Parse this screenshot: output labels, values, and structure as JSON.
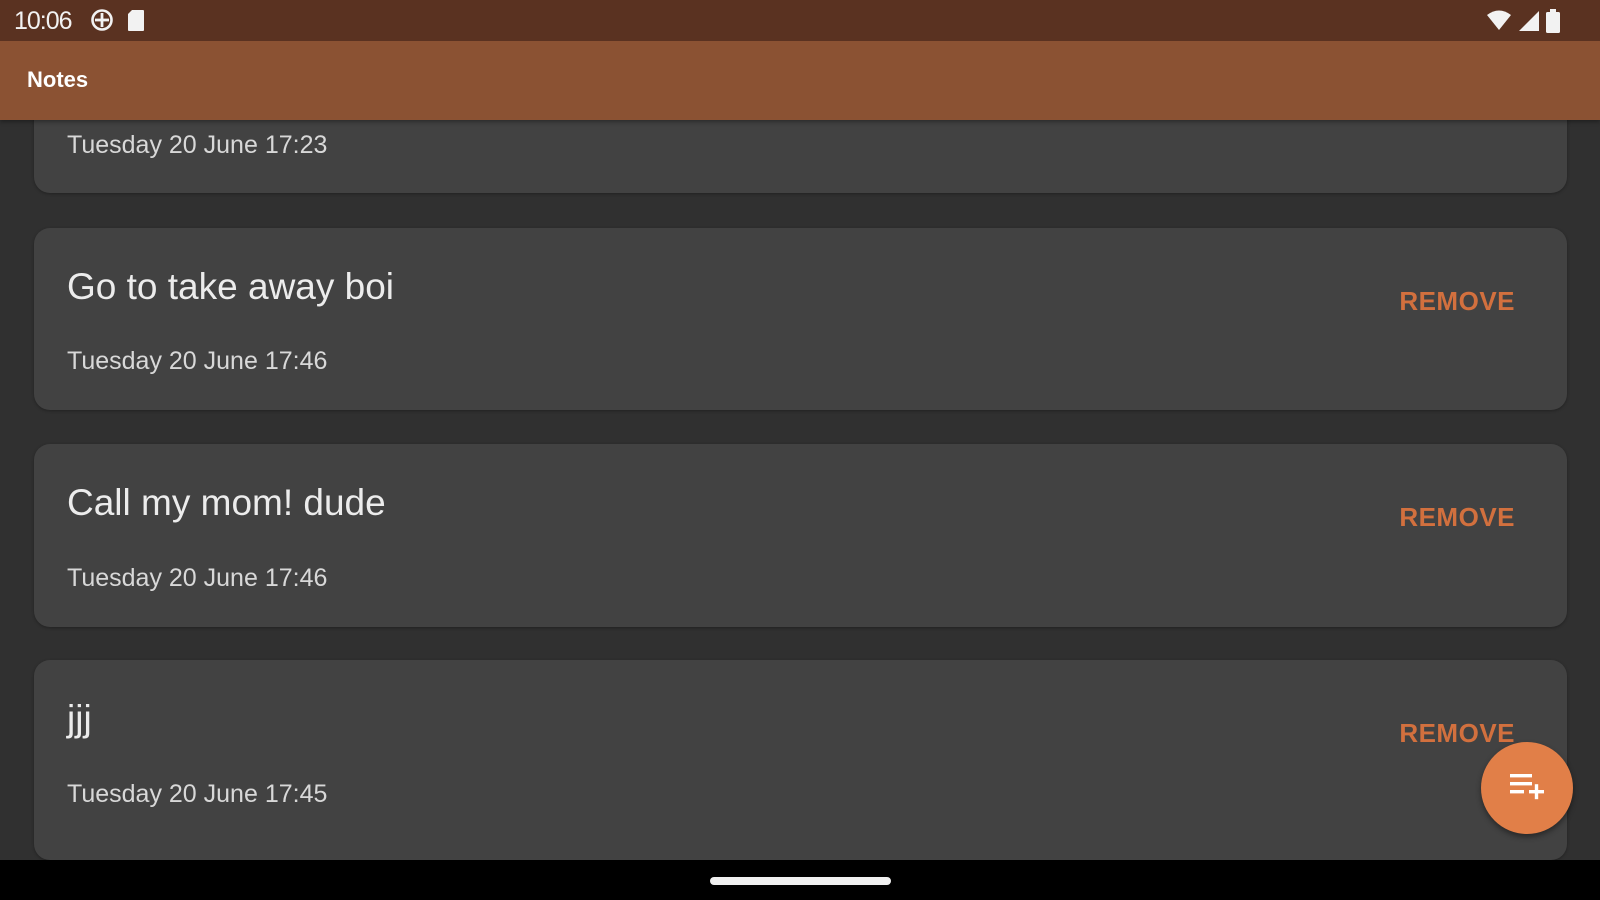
{
  "status_bar": {
    "time": "10:06",
    "left_icons": [
      "vpn-icon",
      "sd-card-icon"
    ],
    "right_icons": [
      "wifi-icon",
      "signal-icon",
      "battery-icon"
    ]
  },
  "app_bar": {
    "title": "Notes"
  },
  "notes": [
    {
      "title": "",
      "date": "Tuesday 20 June 17:23",
      "remove_label": ""
    },
    {
      "title": "Go to take away boi",
      "date": "Tuesday 20 June 17:46",
      "remove_label": "REMOVE"
    },
    {
      "title": "Call my mom! dude",
      "date": "Tuesday 20 June 17:46",
      "remove_label": "REMOVE"
    },
    {
      "title": "jjj",
      "date": "Tuesday 20 June 17:45",
      "remove_label": "REMOVE"
    }
  ],
  "fab": {
    "icon": "playlist-add-icon"
  },
  "colors": {
    "status_bar": "#5a3221",
    "app_bar": "#8b5233",
    "background": "#303030",
    "card": "#424242",
    "accent": "#d2703e",
    "fab": "#e17f48"
  }
}
